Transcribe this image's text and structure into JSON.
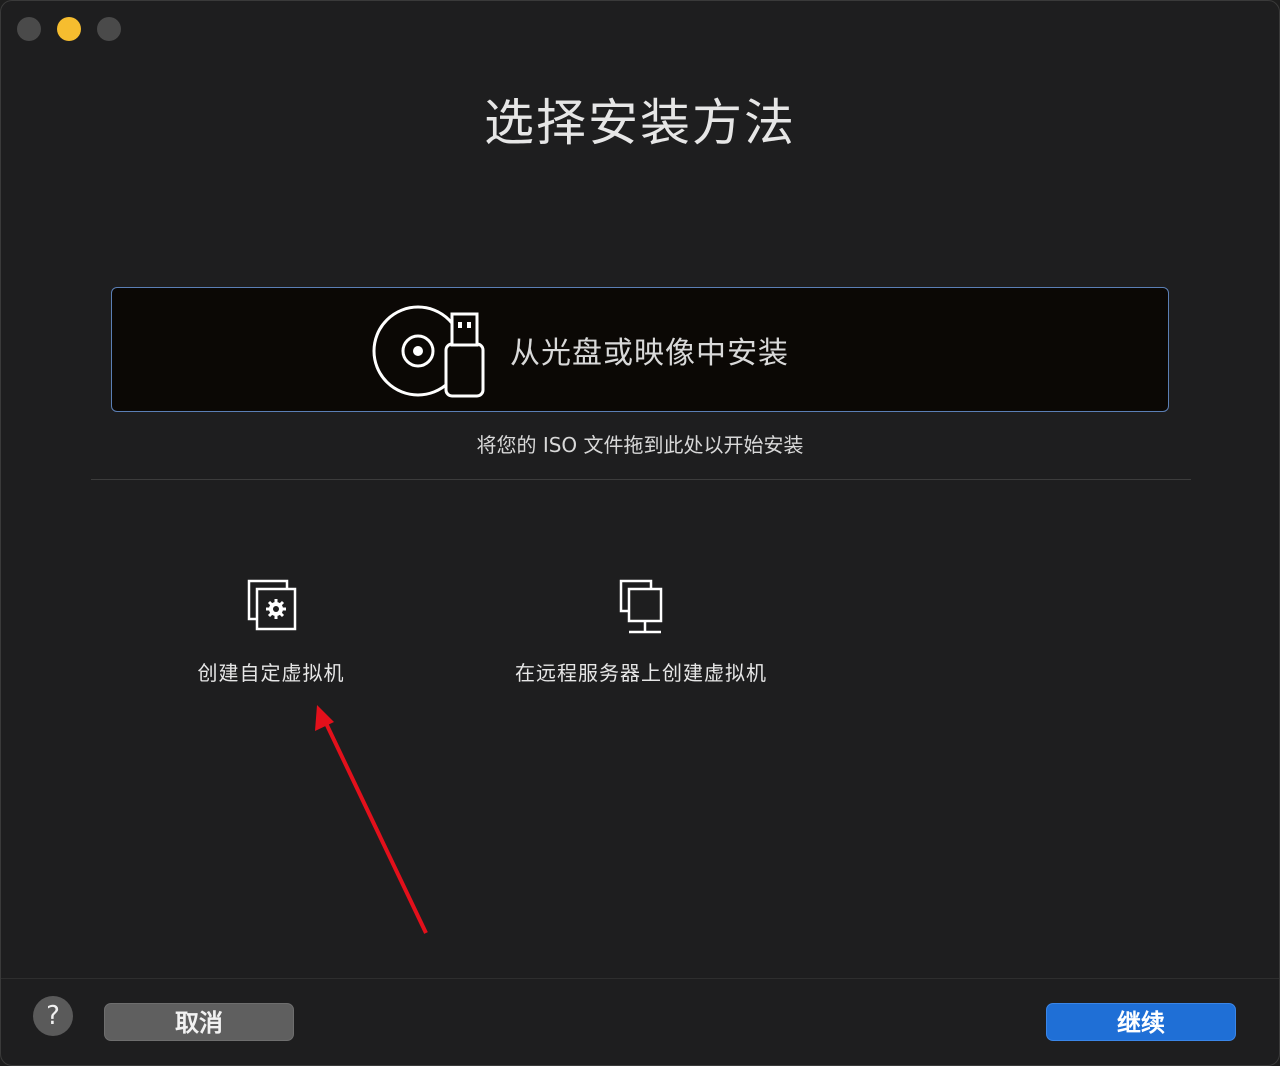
{
  "window": {
    "title": "选择安装方法"
  },
  "install_from_disc": {
    "label": "从光盘或映像中安装",
    "icon": "disc-usb-icon"
  },
  "drag_hint": "将您的 ISO 文件拖到此处以开始安装",
  "options": [
    {
      "label": "创建自定虚拟机",
      "icon": "custom-vm-icon"
    },
    {
      "label": "在远程服务器上创建虚拟机",
      "icon": "remote-server-icon"
    }
  ],
  "footer": {
    "help_label": "?",
    "cancel_label": "取消",
    "continue_label": "继续"
  },
  "colors": {
    "accent": "#1f6fd6",
    "annotation_arrow": "#e3101b",
    "minimize": "#f6bd2f"
  }
}
